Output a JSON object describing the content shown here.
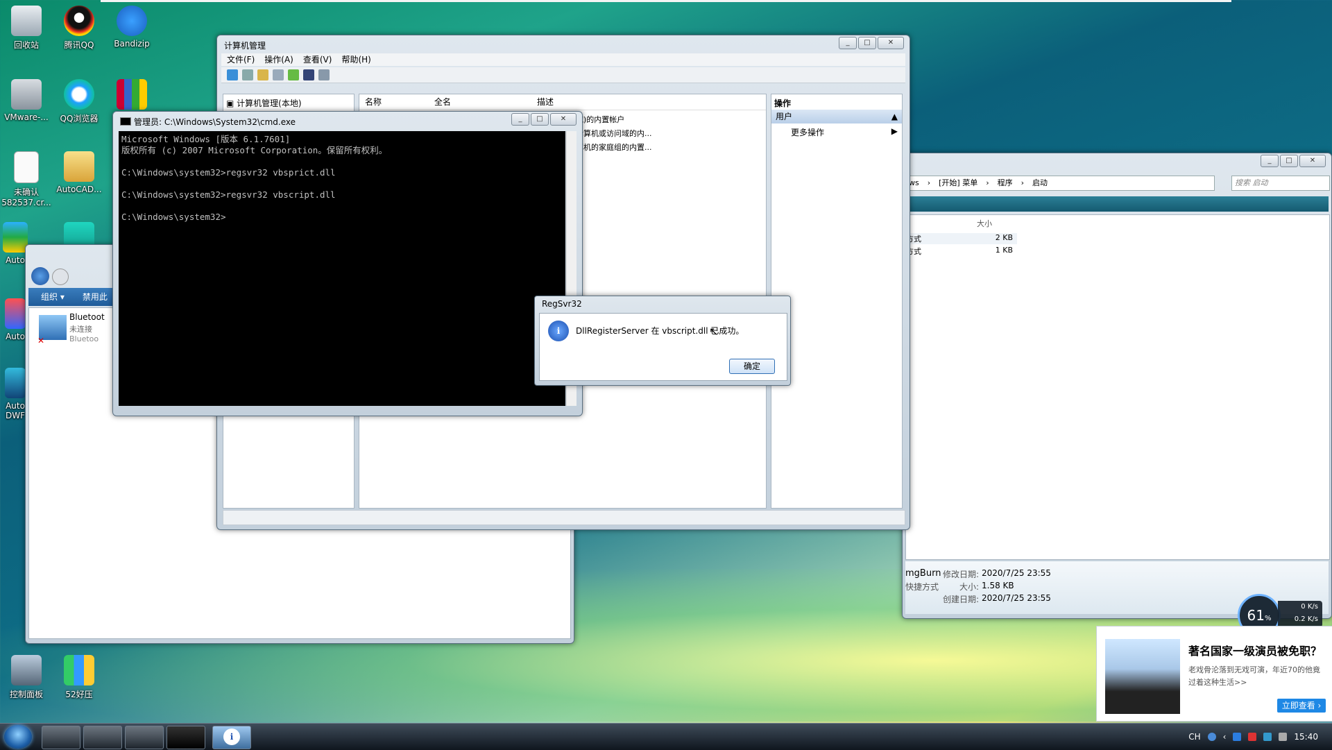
{
  "desktop": {
    "icons": [
      {
        "label": "回收站",
        "name": "recycle-bin-icon"
      },
      {
        "label": "腾讯QQ",
        "name": "qq-icon"
      },
      {
        "label": "Bandizip",
        "name": "bandizip-icon"
      },
      {
        "label": "VMware-...",
        "name": "vmware-icon"
      },
      {
        "label": "QQ浏览器",
        "name": "qq-browser-icon"
      },
      {
        "label": "",
        "name": "winrar-icon"
      },
      {
        "label": "未确认 582537.cr...",
        "name": "file-icon"
      },
      {
        "label": "AutoCAD...",
        "name": "folder-icon"
      },
      {
        "label": "Auto",
        "name": "app-icon"
      },
      {
        "label": "Auto",
        "name": "app-icon-2"
      },
      {
        "label": "Auto DWF",
        "name": "autocad-dwf-icon"
      },
      {
        "label": "控制面板",
        "name": "control-panel-icon"
      },
      {
        "label": "52好压",
        "name": "haozip-icon"
      }
    ]
  },
  "computer_mgmt": {
    "title": "计算机管理",
    "menu": [
      "文件(F)",
      "操作(A)",
      "查看(V)",
      "帮助(H)"
    ],
    "tree_root": "计算机管理(本地)",
    "columns": [
      "名称",
      "全名",
      "描述"
    ],
    "rows": [
      "域)的内置帐户",
      "计算机或访问域的内...",
      "算机的家庭组的内置..."
    ],
    "actions_header": "操作",
    "actions_section": "用户",
    "actions_more": "更多操作"
  },
  "cmd": {
    "title": "管理员: C:\\Windows\\System32\\cmd.exe",
    "lines": [
      "Microsoft Windows [版本 6.1.7601]",
      "版权所有 (c) 2007 Microsoft Corporation。保留所有权利。",
      "",
      "C:\\Windows\\system32>regsvr32 vbsprict.dll",
      "",
      "C:\\Windows\\system32>regsvr32 vbscript.dll",
      "",
      "C:\\Windows\\system32>"
    ]
  },
  "dialog": {
    "title": "RegSvr32",
    "message": "DllRegisterServer 在 vbscript.dll 已成功。",
    "ok": "确定"
  },
  "explorer_left": {
    "organize": "组织 ▾",
    "disable": "禁用此",
    "item_name": "Bluetoot",
    "item_status": "未连接",
    "item_sub": "Bluetoo"
  },
  "explorer_right": {
    "breadcrumb": [
      "ws",
      "[开始] 菜单",
      "程序",
      "启动"
    ],
    "search_placeholder": "搜索 启动",
    "size_header": "大小",
    "rows": [
      {
        "type": "方式",
        "size": "2 KB"
      },
      {
        "type": "方式",
        "size": "1 KB"
      }
    ],
    "detail_name": "mgBurn",
    "detail_type": "快捷方式",
    "modified_label": "修改日期:",
    "modified": "2020/7/25 23:55",
    "size_label": "大小:",
    "size": "1.58 KB",
    "created_label": "创建日期:",
    "created": "2020/7/25 23:55"
  },
  "netmon": {
    "percent": "61",
    "percent_unit": "%",
    "up": "0",
    "down": "0.2",
    "unit": "K/s"
  },
  "ad": {
    "title": "著名国家一级演员被免职？",
    "desc": "老戏骨沦落到无戏可演，年近70的他竟过着这种生活>>",
    "button": "立即查看 ›"
  },
  "taskbar": {
    "tray_lang": "CH",
    "clock": "15:40"
  }
}
